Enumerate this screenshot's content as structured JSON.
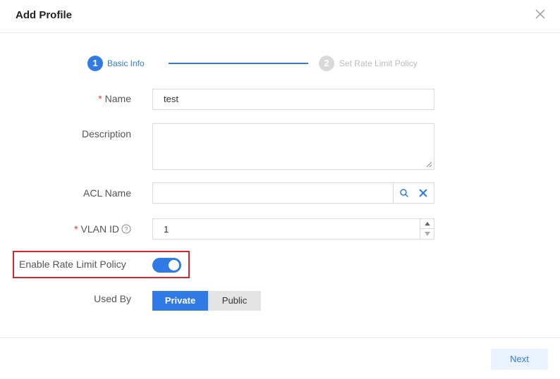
{
  "dialog": {
    "title": "Add Profile"
  },
  "stepper": {
    "steps": [
      {
        "number": "1",
        "label": "Basic Info",
        "state": "active"
      },
      {
        "number": "2",
        "label": "Set Rate Limit Policy",
        "state": "inactive"
      }
    ]
  },
  "form": {
    "required_mark": "*",
    "name": {
      "label": "Name",
      "value": "test"
    },
    "description": {
      "label": "Description",
      "value": ""
    },
    "acl_name": {
      "label": "ACL Name",
      "value": "",
      "icons": [
        "search-icon",
        "clear-icon"
      ]
    },
    "vlan_id": {
      "label": "VLAN ID",
      "value": "1",
      "help_icon": "question-circle-icon"
    },
    "rate_limit": {
      "label": "Enable Rate Limit Policy",
      "enabled": true
    },
    "used_by": {
      "label": "Used By",
      "options": [
        "Private",
        "Public"
      ],
      "selected": "Private"
    }
  },
  "footer": {
    "next_label": "Next"
  },
  "colors": {
    "accent": "#2f7ae5",
    "highlight_border": "#d9242b",
    "required": "#e53935",
    "inactive_step": "#d9d9d9"
  }
}
